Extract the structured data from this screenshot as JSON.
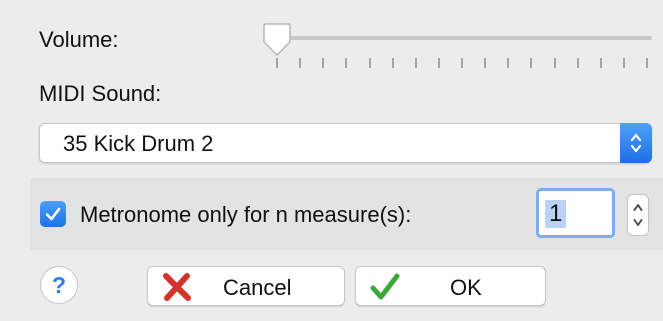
{
  "volume": {
    "label": "Volume:",
    "level": 0.0
  },
  "midi_sound": {
    "label": "MIDI Sound:",
    "selected": "35 Kick Drum 2"
  },
  "metronome": {
    "checkbox_label": "Metronome only for n measure(s):",
    "checked": true,
    "measures_value": "1"
  },
  "buttons": {
    "help_label": "?",
    "cancel_label": "Cancel",
    "ok_label": "OK"
  },
  "colors": {
    "accent": "#1d72e8",
    "cancel_icon": "#d3332d",
    "ok_icon": "#3ca83a"
  }
}
